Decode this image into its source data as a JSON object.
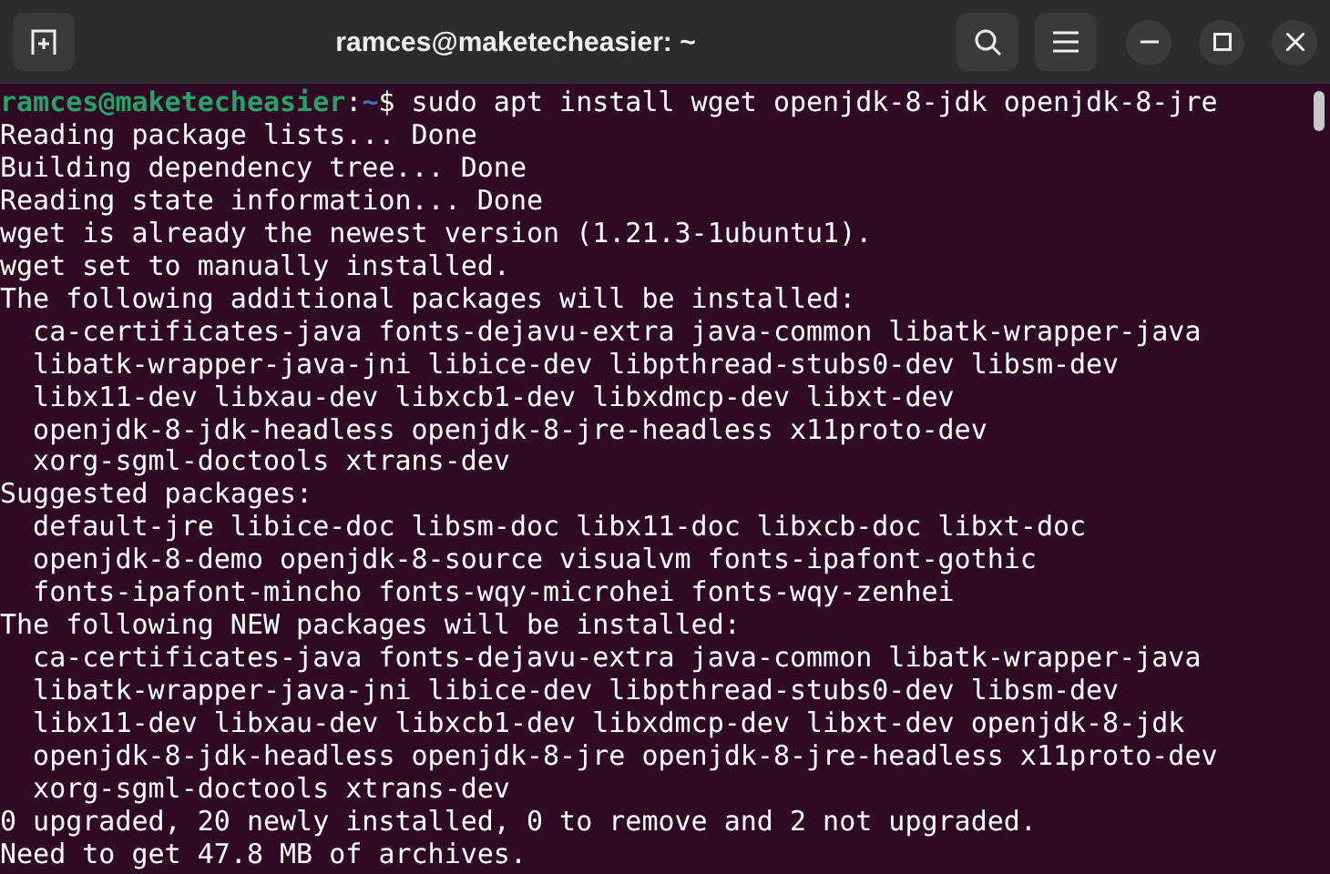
{
  "window": {
    "title": "ramces@maketecheasier: ~"
  },
  "prompt": {
    "user_host": "ramces@maketecheasier",
    "separator": ":",
    "path": "~",
    "symbol": "$",
    "command": "sudo apt install wget openjdk-8-jdk openjdk-8-jre"
  },
  "output": [
    "Reading package lists... Done",
    "Building dependency tree... Done",
    "Reading state information... Done",
    "wget is already the newest version (1.21.3-1ubuntu1).",
    "wget set to manually installed.",
    "The following additional packages will be installed:",
    "  ca-certificates-java fonts-dejavu-extra java-common libatk-wrapper-java",
    "  libatk-wrapper-java-jni libice-dev libpthread-stubs0-dev libsm-dev",
    "  libx11-dev libxau-dev libxcb1-dev libxdmcp-dev libxt-dev",
    "  openjdk-8-jdk-headless openjdk-8-jre-headless x11proto-dev",
    "  xorg-sgml-doctools xtrans-dev",
    "Suggested packages:",
    "  default-jre libice-doc libsm-doc libx11-doc libxcb-doc libxt-doc",
    "  openjdk-8-demo openjdk-8-source visualvm fonts-ipafont-gothic",
    "  fonts-ipafont-mincho fonts-wqy-microhei fonts-wqy-zenhei",
    "The following NEW packages will be installed:",
    "  ca-certificates-java fonts-dejavu-extra java-common libatk-wrapper-java",
    "  libatk-wrapper-java-jni libice-dev libpthread-stubs0-dev libsm-dev",
    "  libx11-dev libxau-dev libxcb1-dev libxdmcp-dev libxt-dev openjdk-8-jdk",
    "  openjdk-8-jdk-headless openjdk-8-jre openjdk-8-jre-headless x11proto-dev",
    "  xorg-sgml-doctools xtrans-dev",
    "0 upgraded, 20 newly installed, 0 to remove and 2 not upgraded.",
    "Need to get 47.8 MB of archives."
  ]
}
